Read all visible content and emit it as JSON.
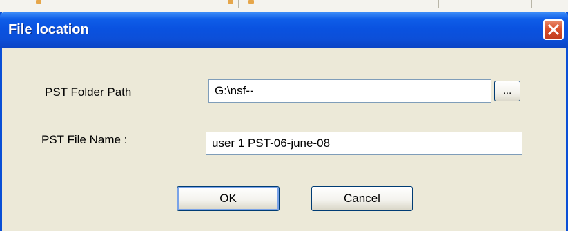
{
  "dialog": {
    "title": "File location",
    "close_symbol": "✕"
  },
  "form": {
    "folder_path_label": "PST Folder Path",
    "folder_path_value": "G:\\nsf--",
    "browse_label": "...",
    "file_name_label": "PST File Name :",
    "file_name_value": "user 1 PST-06-june-08"
  },
  "buttons": {
    "ok_label": "OK",
    "cancel_label": "Cancel"
  },
  "colors": {
    "titlebar": "#0a52e0",
    "close_button": "#d9512c",
    "dialog_background": "#ece9d8"
  }
}
